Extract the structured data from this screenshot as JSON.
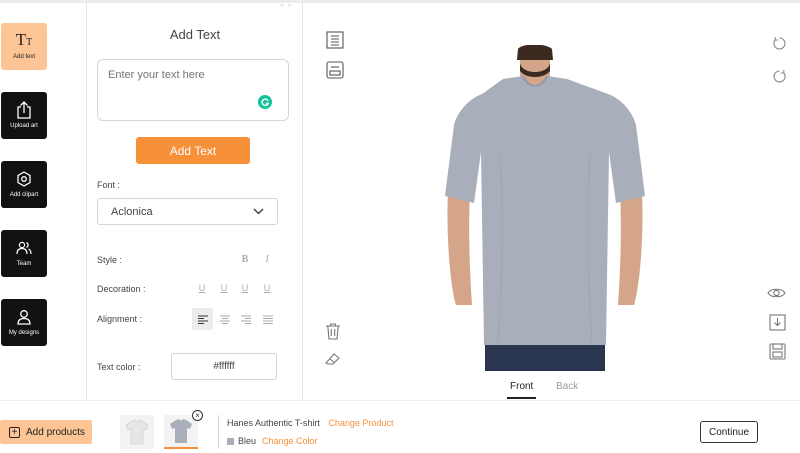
{
  "tools": [
    {
      "label": "Add text",
      "icon": "text-tool-icon",
      "glyph": "T",
      "glyph_small": "T"
    },
    {
      "label": "Upload art",
      "icon": "upload-icon"
    },
    {
      "label": "Add clipart",
      "icon": "clipart-icon"
    },
    {
      "label": "Team",
      "icon": "team-icon"
    },
    {
      "label": "My designs",
      "icon": "user-icon"
    }
  ],
  "panel": {
    "title": "Add Text",
    "text_placeholder": "Enter your text here",
    "add_button": "Add Text",
    "font_label": "Font :",
    "font_value": "Aclonica",
    "style_label": "Style :",
    "style_bold": "B",
    "style_italic": "I",
    "decoration_label": "Decoration :",
    "decoration_glyphs": [
      "U",
      "U",
      "U",
      "U"
    ],
    "alignment_label": "Alignment :",
    "alignment_selected": "left",
    "text_color_label": "Text color :",
    "text_color_value": "#ffffff"
  },
  "canvas": {
    "tshirt_color": "#a9aebb",
    "views": [
      "Front",
      "Back"
    ],
    "active_view": "Front"
  },
  "footer": {
    "add_products": "Add products",
    "product_name": "Hanes Authentic T-shirt",
    "change_product": "Change Product",
    "color_name": "Bleu",
    "change_color": "Change Color",
    "continue": "Continue",
    "remove_glyph": "×"
  },
  "colors": {
    "accent": "#f6913a",
    "accent_light": "#fdc596",
    "tool_bg": "#111111"
  }
}
